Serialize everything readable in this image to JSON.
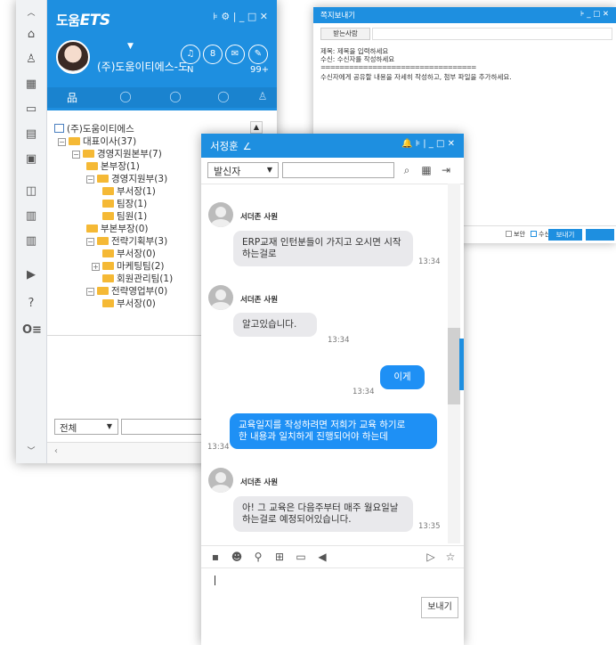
{
  "org": {
    "logo_prefix": "도움",
    "logo_brand": "ETS",
    "header_controls": "⊧ ⚙ | _ □ ✕",
    "company_name": "(주)도움이티에스-도",
    "notify_count": "N",
    "badge_count": "99+",
    "tabs": [
      "조직도",
      "대화",
      "채팅",
      "채팅방",
      "My"
    ],
    "tree": [
      {
        "label": "(주)도움이티에스"
      },
      {
        "label": "대표이사(37)"
      },
      {
        "label": "경영지원본부(7)"
      },
      {
        "label": "본부장(1)"
      },
      {
        "label": "경영지원부(3)"
      },
      {
        "label": "부서장(1)"
      },
      {
        "label": "팀장(1)"
      },
      {
        "label": "팀원(1)"
      },
      {
        "label": "부본부장(0)"
      },
      {
        "label": "전략기획부(3)"
      },
      {
        "label": "부서장(0)"
      },
      {
        "label": "마케팅팀(2)"
      },
      {
        "label": "회원관리팀(1)"
      },
      {
        "label": "전략영업부(0)"
      },
      {
        "label": "부서장(0)"
      }
    ],
    "filter_value": "전체"
  },
  "note": {
    "title": "쪽지보내기",
    "controls": "⊧ _ □ ✕",
    "recv_button": "받는사람",
    "subject_hint": "제목: 제목을 입력하세요",
    "recv_hint": "수신: 수신자를 작성하세요",
    "divider": "=================================",
    "body_hint": "수신자에게 공유할 내용을 자세히 작성하고, 첨부 파일을 추가하세요.",
    "secure_label": "보안",
    "confirm_label": "수신확인",
    "send_label": "보내기"
  },
  "chat": {
    "title": "서정훈",
    "controls": "🔔 ⊧ | _ □ ✕",
    "sender_select": "발신자",
    "messages": [
      {
        "sender": "서더존 사원",
        "text_line1": "ERP교재 인턴분들이 가지고 오시면 시작",
        "text_line2": "하는걸로",
        "time": "13:34"
      },
      {
        "sender": "서더존 사원",
        "text": "알고있습니다.",
        "time": "13:34"
      },
      {
        "text": "이게",
        "time": "13:34"
      },
      {
        "text_line1": "교육일지를 작성하려면 저희가 교육 하기로",
        "text_line2": "한 내용과 일치하게 진행되어야 하는데",
        "time": "13:34"
      },
      {
        "sender": "서더존 사원",
        "text_line1": "아! 그 교육은 다음주부터 매주 월요일날",
        "text_line2": "하는걸로 예정되어있습니다.",
        "time": "13:35"
      }
    ],
    "send_label": "보내기"
  }
}
